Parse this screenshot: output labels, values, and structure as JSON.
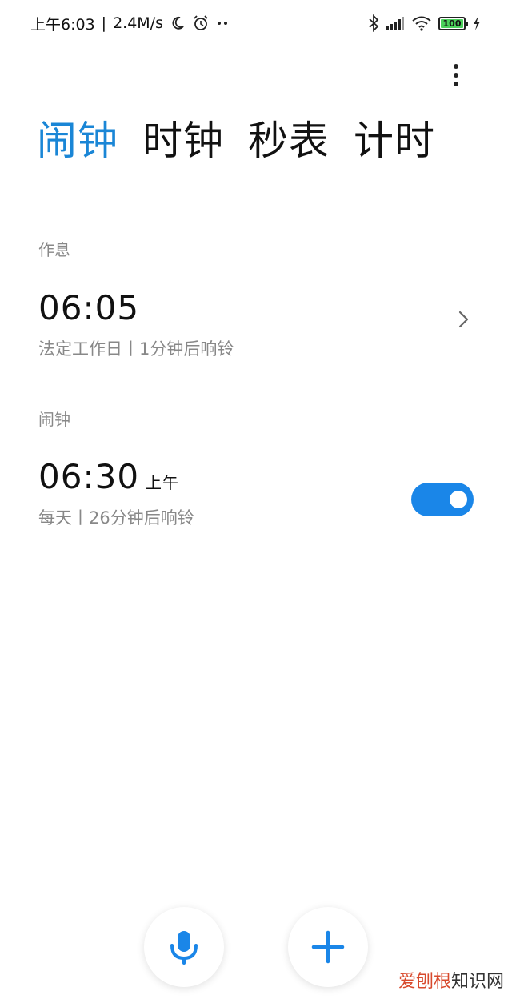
{
  "status_bar": {
    "time": "上午6:03",
    "network_speed": "2.4M/s",
    "battery": "100",
    "icons": [
      "moon-icon",
      "alarm-icon",
      "more-dots-icon",
      "bluetooth-icon",
      "signal-icon",
      "wifi-icon",
      "battery-icon",
      "charging-icon"
    ]
  },
  "tabs": [
    {
      "label": "闹钟",
      "active": true
    },
    {
      "label": "时钟",
      "active": false
    },
    {
      "label": "秒表",
      "active": false
    },
    {
      "label": "计时",
      "active": false
    }
  ],
  "sections": {
    "schedule": {
      "label": "作息",
      "alarm": {
        "time": "06:05",
        "subtitle": "法定工作日丨1分钟后响铃"
      }
    },
    "alarms": {
      "label": "闹钟",
      "alarm": {
        "time": "06:30",
        "ampm": "上午",
        "subtitle": "每天丨26分钟后响铃",
        "enabled": true
      }
    }
  },
  "watermark": {
    "brand": "爱刨根",
    "site": "知识网"
  },
  "colors": {
    "accent": "#1a86d6",
    "toggle": "#1a86e8",
    "muted": "#888888"
  }
}
